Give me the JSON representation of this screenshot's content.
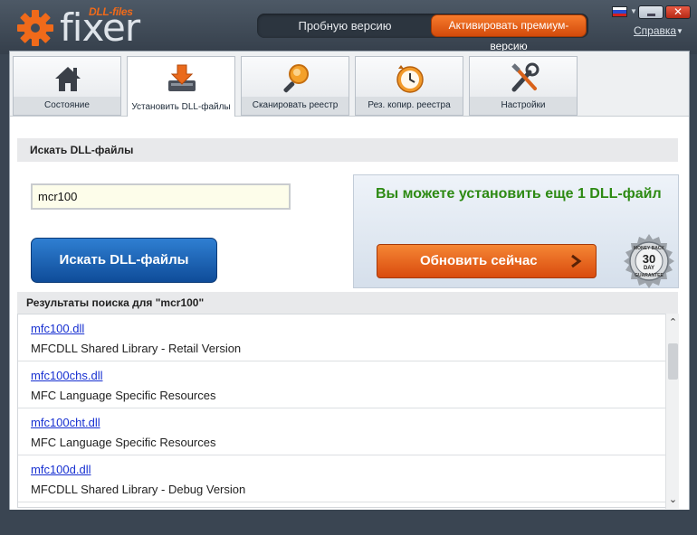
{
  "app": {
    "logo_word": "fixer",
    "logo_sup": "DLL-files",
    "trial_label": "Пробную версию",
    "premium_label": "Активировать премиум-версию",
    "help_label": "Справка",
    "close_glyph": "✕",
    "accent_color": "#f06a1a"
  },
  "tabs": [
    {
      "label": "Состояние",
      "icon": "home-icon"
    },
    {
      "label": "Установить DLL-файлы",
      "icon": "download-icon"
    },
    {
      "label": "Сканировать реестр",
      "icon": "magnifier-icon"
    },
    {
      "label": "Рез. копир. реестра",
      "icon": "clock-backup-icon"
    },
    {
      "label": "Настройки",
      "icon": "tools-icon"
    }
  ],
  "search": {
    "section_title": "Искать DLL-файлы",
    "input_value": "mcr100",
    "button_label": "Искать DLL-файлы"
  },
  "promo": {
    "text": "Вы можете установить еще 1 DLL-файл",
    "button_label": "Обновить сейчас",
    "seal_lines": [
      "MONEY BACK",
      "30",
      "DAY",
      "GUARANTEE"
    ]
  },
  "results": {
    "title": "Результаты поиска для \"mcr100\"",
    "items": [
      {
        "name": "mfc100.dll",
        "desc": "MFCDLL Shared Library - Retail Version"
      },
      {
        "name": "mfc100chs.dll",
        "desc": "MFC Language Specific Resources"
      },
      {
        "name": "mfc100cht.dll",
        "desc": "MFC Language Specific Resources"
      },
      {
        "name": "mfc100d.dll",
        "desc": "MFCDLL Shared Library - Debug Version"
      }
    ]
  }
}
